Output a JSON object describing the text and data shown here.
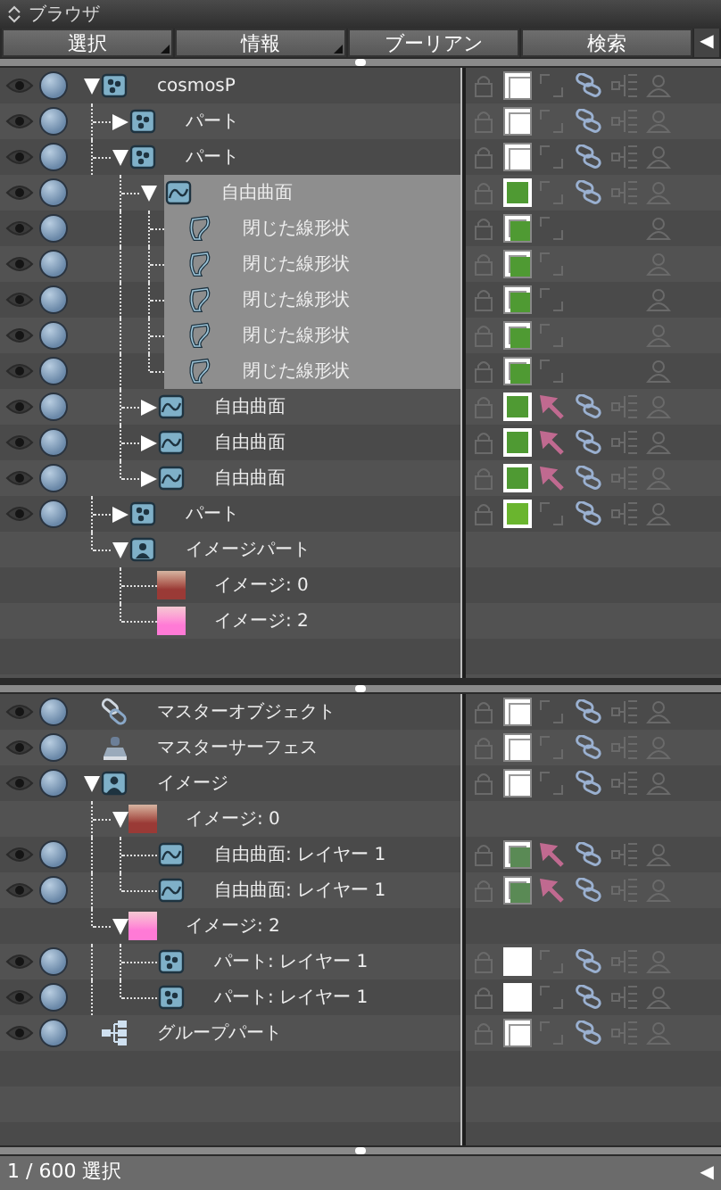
{
  "window": {
    "title": "ブラウザ"
  },
  "tabs": [
    {
      "label": "選択",
      "has_menu": true
    },
    {
      "label": "情報",
      "has_menu": true
    },
    {
      "label": "ブーリアン",
      "has_menu": false
    },
    {
      "label": "検索",
      "has_menu": false
    }
  ],
  "collapse_button": "◀",
  "top_tree": [
    {
      "name": "cosmosP",
      "kind": "part",
      "expanded": true,
      "selected": false,
      "controls": true,
      "material": {
        "color": "#ffffff",
        "kind": "framed"
      },
      "arrow": false,
      "chain": true,
      "children": [
        {
          "name": "パート",
          "kind": "part",
          "expanded": false,
          "selected": false,
          "controls": true,
          "material": {
            "color": "#ffffff",
            "kind": "framed"
          },
          "arrow": false,
          "chain": true
        },
        {
          "name": "パート",
          "kind": "part",
          "expanded": true,
          "selected": false,
          "controls": true,
          "material": {
            "color": "#ffffff",
            "kind": "framed"
          },
          "arrow": false,
          "chain": true,
          "children": [
            {
              "name": "自由曲面",
              "kind": "surface",
              "expanded": true,
              "selected": true,
              "controls": true,
              "material": {
                "color": "#4f9a33",
                "kind": "full"
              },
              "arrow": false,
              "chain": true,
              "children": [
                {
                  "name": "閉じた線形状",
                  "kind": "line",
                  "selected": true,
                  "controls": true,
                  "material": {
                    "color": "#4f9a33",
                    "kind": "inset"
                  },
                  "arrow": false,
                  "chain": false
                },
                {
                  "name": "閉じた線形状",
                  "kind": "line",
                  "selected": true,
                  "controls": true,
                  "material": {
                    "color": "#4f9a33",
                    "kind": "inset"
                  },
                  "arrow": false,
                  "chain": false
                },
                {
                  "name": "閉じた線形状",
                  "kind": "line",
                  "selected": true,
                  "controls": true,
                  "material": {
                    "color": "#4f9a33",
                    "kind": "inset"
                  },
                  "arrow": false,
                  "chain": false
                },
                {
                  "name": "閉じた線形状",
                  "kind": "line",
                  "selected": true,
                  "controls": true,
                  "material": {
                    "color": "#4f9a33",
                    "kind": "inset"
                  },
                  "arrow": false,
                  "chain": false
                },
                {
                  "name": "閉じた線形状",
                  "kind": "line",
                  "selected": true,
                  "controls": true,
                  "material": {
                    "color": "#4f9a33",
                    "kind": "inset"
                  },
                  "arrow": false,
                  "chain": false
                }
              ]
            },
            {
              "name": "自由曲面",
              "kind": "surface",
              "expanded": false,
              "selected": false,
              "controls": true,
              "material": {
                "color": "#4f9a33",
                "kind": "full"
              },
              "arrow": true,
              "chain": true
            },
            {
              "name": "自由曲面",
              "kind": "surface",
              "expanded": false,
              "selected": false,
              "controls": true,
              "material": {
                "color": "#4f9a33",
                "kind": "full"
              },
              "arrow": true,
              "chain": true
            },
            {
              "name": "自由曲面",
              "kind": "surface",
              "expanded": false,
              "selected": false,
              "controls": true,
              "material": {
                "color": "#4f9a33",
                "kind": "full"
              },
              "arrow": true,
              "chain": true
            }
          ]
        },
        {
          "name": "パート",
          "kind": "part",
          "expanded": false,
          "selected": false,
          "controls": true,
          "material": {
            "color": "#6ab52e",
            "kind": "full"
          },
          "arrow": false,
          "chain": true
        },
        {
          "name": "イメージパート",
          "kind": "image-part",
          "expanded": true,
          "selected": false,
          "controls": false,
          "children": [
            {
              "name": "イメージ: 0",
              "kind": "swatch",
              "color": "#9a3a36",
              "selected": false,
              "controls": false
            },
            {
              "name": "イメージ: 2",
              "kind": "swatch",
              "color": "#ff7ad6",
              "selected": false,
              "controls": false
            }
          ]
        }
      ]
    }
  ],
  "bottom_tree": [
    {
      "name": "マスターオブジェクト",
      "kind": "master-object",
      "selected": false,
      "controls": true,
      "material": {
        "color": "#ffffff",
        "kind": "framed"
      },
      "arrow": false,
      "chain": true
    },
    {
      "name": "マスターサーフェス",
      "kind": "master-surface",
      "selected": false,
      "controls": true,
      "material": {
        "color": "#ffffff",
        "kind": "framed"
      },
      "arrow": false,
      "chain": true
    },
    {
      "name": "イメージ",
      "kind": "image-folder",
      "expanded": true,
      "selected": false,
      "controls": true,
      "material": {
        "color": "#ffffff",
        "kind": "framed"
      },
      "arrow": false,
      "chain": true,
      "children": [
        {
          "name": "イメージ: 0",
          "kind": "swatch",
          "color": "#9a3a36",
          "expanded": true,
          "selected": false,
          "controls": false,
          "children": [
            {
              "name": "自由曲面: レイヤー 1",
              "kind": "surface",
              "selected": false,
              "controls": true,
              "material": {
                "color": "#5a8a55",
                "kind": "inset"
              },
              "arrow": true,
              "chain": true
            },
            {
              "name": "自由曲面: レイヤー 1",
              "kind": "surface",
              "selected": false,
              "controls": true,
              "material": {
                "color": "#5a8a55",
                "kind": "inset"
              },
              "arrow": true,
              "chain": true
            }
          ]
        },
        {
          "name": "イメージ: 2",
          "kind": "swatch",
          "color": "#ff7ad6",
          "expanded": true,
          "selected": false,
          "controls": false,
          "children": [
            {
              "name": "パート: レイヤー 1",
              "kind": "part",
              "selected": false,
              "controls": true,
              "material": {
                "color": "#ffffff",
                "kind": "full"
              },
              "arrow": false,
              "chain": true
            },
            {
              "name": "パート: レイヤー 1",
              "kind": "part",
              "selected": false,
              "controls": true,
              "material": {
                "color": "#ffffff",
                "kind": "full"
              },
              "arrow": false,
              "chain": true
            }
          ]
        }
      ]
    },
    {
      "name": "グループパート",
      "kind": "group",
      "selected": false,
      "controls": true,
      "material": {
        "color": "#ffffff",
        "kind": "framed"
      },
      "arrow": false,
      "chain": true
    }
  ],
  "status_bar": {
    "text": "1 / 600 選択",
    "button": "◀"
  }
}
